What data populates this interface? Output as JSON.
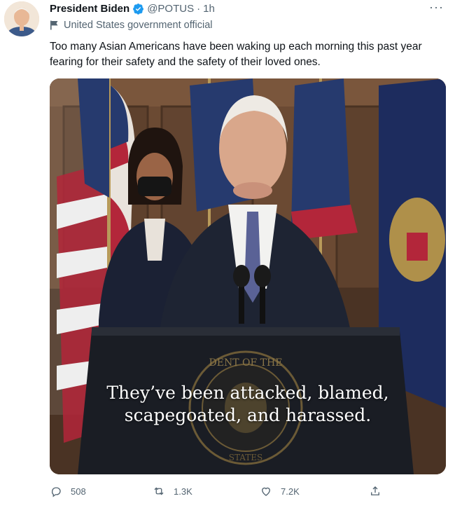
{
  "author": {
    "name": "President Biden",
    "handle": "@POTUS",
    "time": "1h",
    "dot": "·",
    "label": "United States government official"
  },
  "tweet": {
    "text": "Too many Asian Americans have been waking up each morning this past year fearing for their safety and the safety of their loved ones."
  },
  "media": {
    "caption_line1": "They’ve been attacked, blamed,",
    "caption_line2": "scapegoated, and harassed.",
    "seal_text": "DENT OF THE",
    "seal_text_bottom": "STATES"
  },
  "actions": {
    "replies": "508",
    "retweets": "1.3K",
    "likes": "7.2K"
  },
  "more_label": "···",
  "colors": {
    "text": "#0f1419",
    "secondary": "#536471",
    "verified": "#1d9bf0"
  },
  "icons": [
    "verified-badge-icon",
    "more-icon",
    "government-flag-icon",
    "reply-icon",
    "retweet-icon",
    "like-icon",
    "share-icon"
  ]
}
